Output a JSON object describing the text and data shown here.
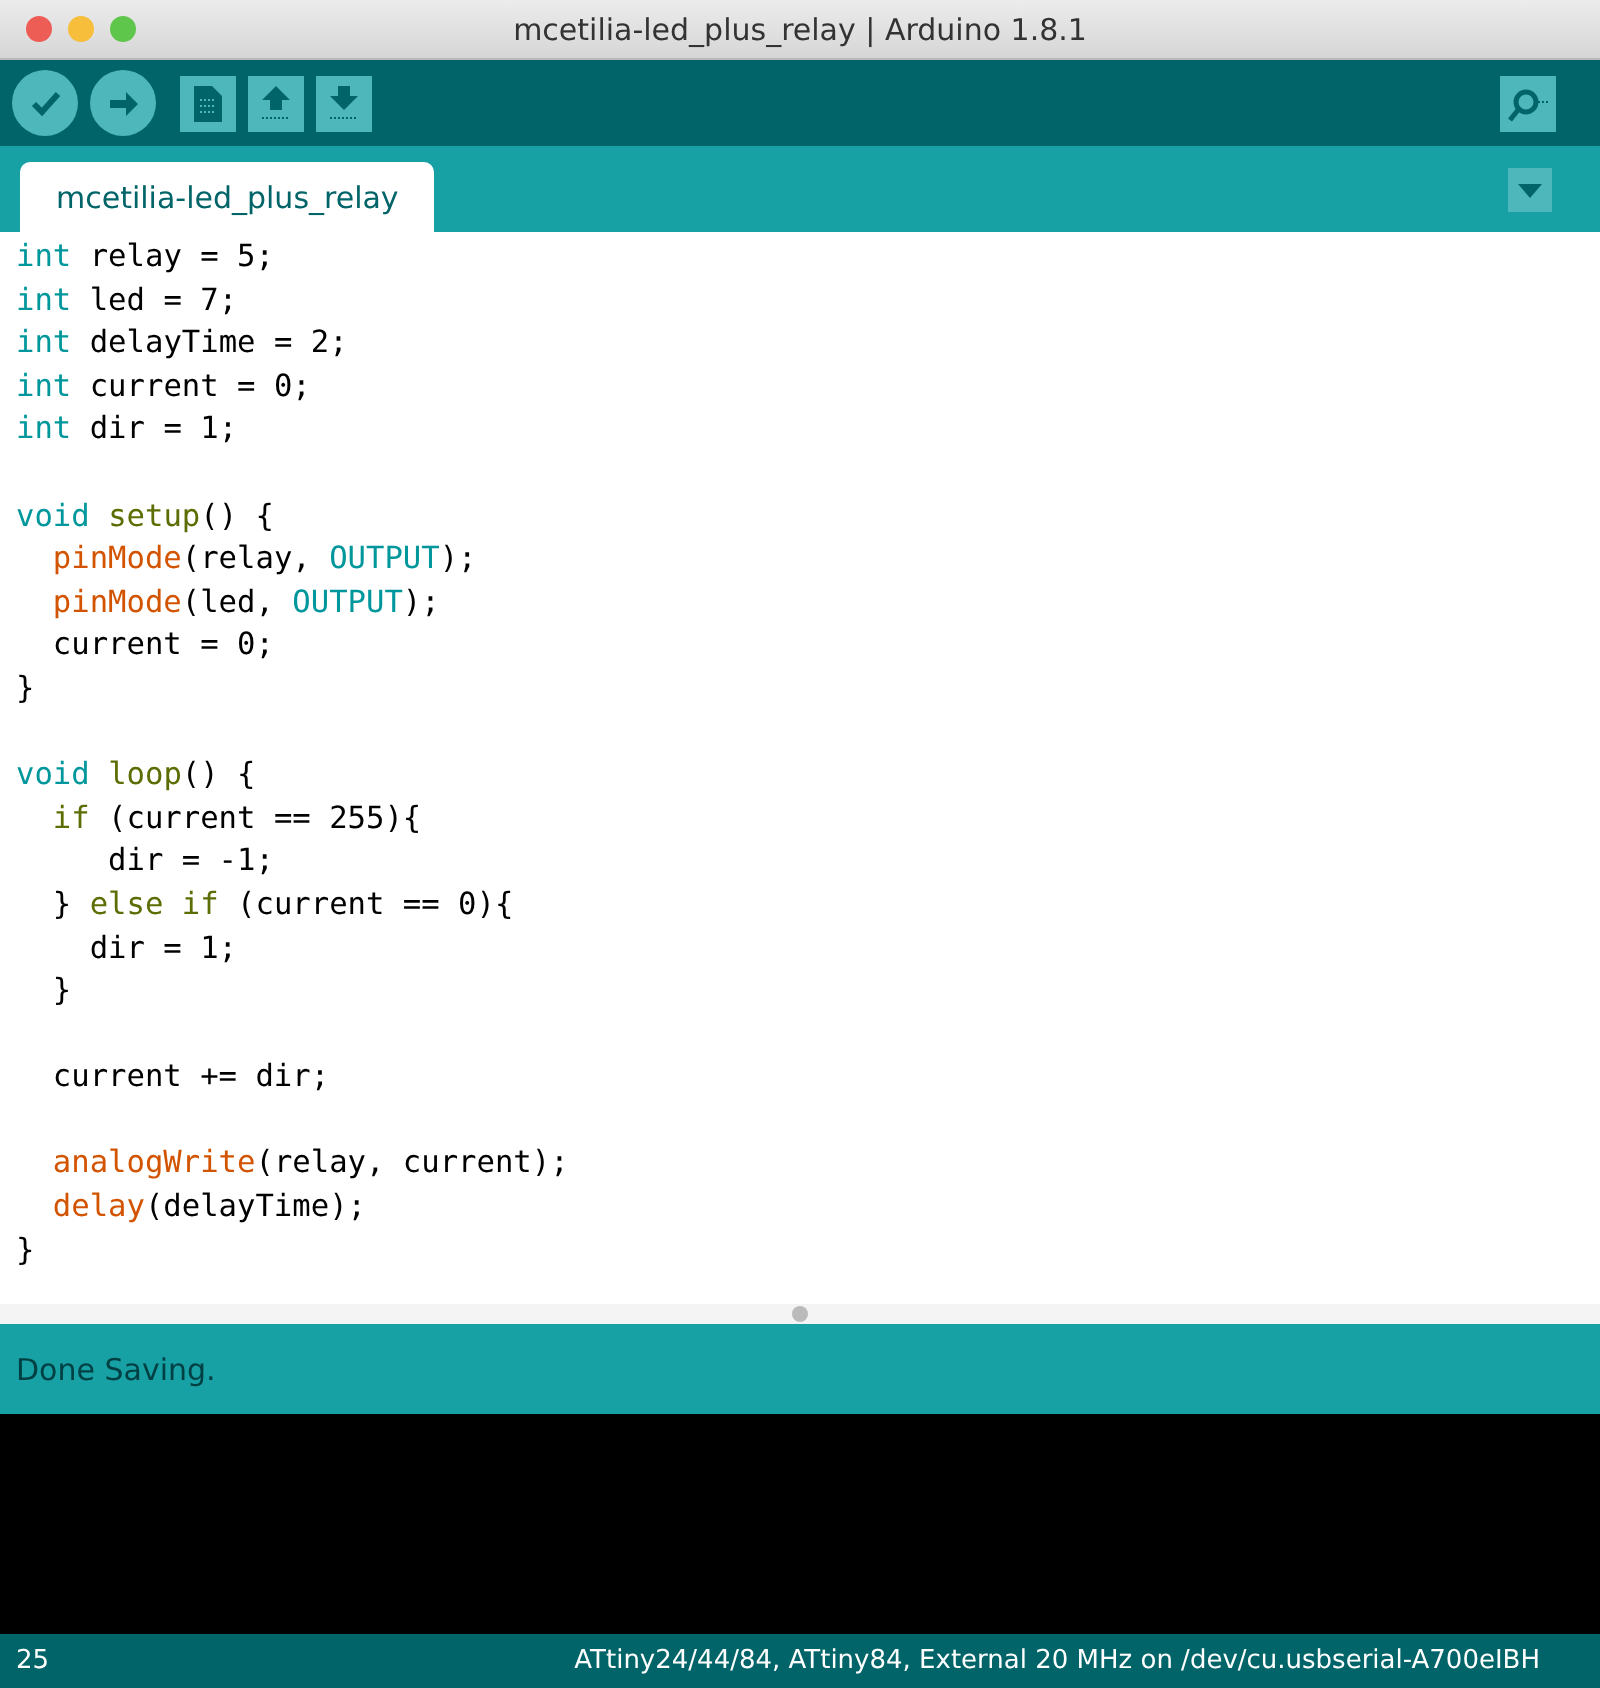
{
  "window": {
    "title": "mcetilia-led_plus_relay | Arduino 1.8.1"
  },
  "toolbar": {
    "buttons": [
      {
        "kind": "verify"
      },
      {
        "kind": "upload"
      },
      {
        "kind": "new"
      },
      {
        "kind": "open"
      },
      {
        "kind": "save"
      }
    ],
    "right_button": {
      "kind": "serial"
    }
  },
  "tabs": [
    {
      "label": "mcetilia-led_plus_relay",
      "selected": true
    }
  ],
  "editor": {
    "blocks": [
      [
        [
          {
            "kind": "type",
            "text": "int"
          },
          {
            "kind": "plain",
            "text": " relay = 5;"
          }
        ],
        [
          {
            "kind": "type",
            "text": "int"
          },
          {
            "kind": "plain",
            "text": " led = 7;"
          }
        ],
        [
          {
            "kind": "type",
            "text": "int"
          },
          {
            "kind": "plain",
            "text": " delayTime = 2;"
          }
        ],
        [
          {
            "kind": "type",
            "text": "int"
          },
          {
            "kind": "plain",
            "text": " current = 0;"
          }
        ],
        [
          {
            "kind": "type",
            "text": "int"
          },
          {
            "kind": "plain",
            "text": " dir = 1;"
          }
        ]
      ],
      [
        [
          {
            "kind": "type",
            "text": "void "
          },
          {
            "kind": "keyword",
            "text": "setup"
          },
          {
            "kind": "plain",
            "text": "() {"
          }
        ],
        [
          {
            "kind": "function",
            "text": "  pinMode"
          },
          {
            "kind": "plain",
            "text": "(relay, "
          },
          {
            "kind": "constant",
            "text": "OUTPUT"
          },
          {
            "kind": "plain",
            "text": ");"
          }
        ],
        [
          {
            "kind": "function",
            "text": "  pinMode"
          },
          {
            "kind": "plain",
            "text": "(led, "
          },
          {
            "kind": "constant",
            "text": "OUTPUT"
          },
          {
            "kind": "plain",
            "text": ");"
          }
        ],
        [
          {
            "kind": "plain",
            "text": "  current = 0;"
          }
        ],
        [
          {
            "kind": "plain",
            "text": "}"
          }
        ]
      ],
      [
        [
          {
            "kind": "type",
            "text": "void "
          },
          {
            "kind": "keyword",
            "text": "loop"
          },
          {
            "kind": "plain",
            "text": "() {"
          }
        ],
        [
          {
            "kind": "keyword",
            "text": "  if"
          },
          {
            "kind": "plain",
            "text": " (current == 255){"
          }
        ],
        [
          {
            "kind": "plain",
            "text": "     dir = -1;"
          }
        ],
        [
          {
            "kind": "plain",
            "text": "  } "
          },
          {
            "kind": "keyword",
            "text": "else if"
          },
          {
            "kind": "plain",
            "text": " (current == 0){"
          }
        ],
        [
          {
            "kind": "plain",
            "text": "    dir = 1;"
          }
        ],
        [
          {
            "kind": "plain",
            "text": "  }"
          }
        ]
      ],
      [
        [
          {
            "kind": "plain",
            "text": "  current += dir;"
          }
        ]
      ],
      [
        [
          {
            "kind": "function",
            "text": "  analogWrite"
          },
          {
            "kind": "plain",
            "text": "(relay, current);"
          }
        ],
        [
          {
            "kind": "function",
            "text": "  delay"
          },
          {
            "kind": "plain",
            "text": "(delayTime);"
          }
        ],
        [
          {
            "kind": "plain",
            "text": "}"
          }
        ]
      ]
    ]
  },
  "message": "Done Saving.",
  "status_bar": {
    "line": "25",
    "board": "ATtiny24/44/84, ATtiny84, External 20 MHz on /dev/cu.usbserial-A700eIBH"
  }
}
